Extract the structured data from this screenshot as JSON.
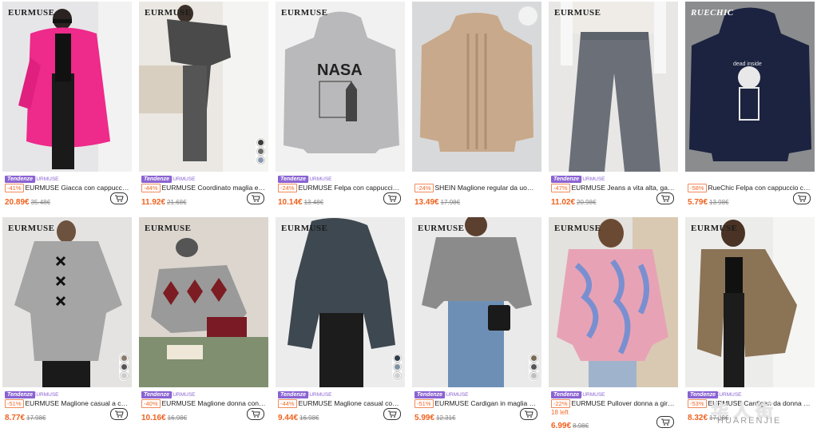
{
  "products": [
    {
      "brand": "EURMUSE",
      "badge": "Tendenze",
      "store": "EURMUSE",
      "discount": "-41%",
      "title": "EURMUSE Giacca con cappuccio versat...",
      "price": "20.89€",
      "original": "35.48€",
      "swatches": [],
      "stock": ""
    },
    {
      "brand": "EURMUSE",
      "badge": "Tendenze",
      "store": "EURMUSE",
      "discount": "-44%",
      "title": "EURMUSE Coordinato maglia e pantalo...",
      "price": "11.92€",
      "original": "21.68€",
      "swatches": [
        "#3a3a3a",
        "#6b6b6b",
        "#8a9bb0"
      ],
      "stock": ""
    },
    {
      "brand": "EURMUSE",
      "badge": "Tendenze",
      "store": "EURMUSE",
      "discount": "-24%",
      "title": "EURMUSE Felpa con cappuccio regular ...",
      "price": "10.14€",
      "original": "13.48€",
      "swatches": [],
      "stock": ""
    },
    {
      "brand": "",
      "badge": "",
      "store": "",
      "discount": "-24%",
      "title": "SHEIN Maglione regular da uomo a collo...",
      "price": "13.49€",
      "original": "17.98€",
      "swatches": [],
      "stock": ""
    },
    {
      "brand": "EURMUSE",
      "badge": "Tendenze",
      "store": "EURMUSE",
      "discount": "-47%",
      "title": "EURMUSE Jeans a vita alta, gamba dritt...",
      "price": "11.02€",
      "original": "20.98€",
      "swatches": [],
      "stock": ""
    },
    {
      "brand": "RUECHIC",
      "badge": "",
      "store": "",
      "discount": "-58%",
      "title": "RueChic Felpa con cappuccio casual da ...",
      "price": "5.79€",
      "original": "13.98€",
      "swatches": [],
      "stock": ""
    },
    {
      "brand": "EURMUSE",
      "badge": "Tendenze",
      "store": "EURMUSE",
      "discount": "-51%",
      "title": "EURMUSE Maglione casual a costine co...",
      "price": "8.77€",
      "original": "17.98€",
      "swatches": [
        "#8a7a6a",
        "#555",
        "#ccc"
      ],
      "stock": ""
    },
    {
      "brand": "EURMUSE",
      "badge": "Tendenze",
      "store": "EURMUSE",
      "discount": "-40%",
      "title": "EURMUSE Maglione donna con collo a ...",
      "price": "10.16€",
      "original": "16.98€",
      "swatches": [],
      "stock": ""
    },
    {
      "brand": "EURMUSE",
      "badge": "Tendenze",
      "store": "EURMUSE",
      "discount": "-44%",
      "title": "EURMUSE Maglione casual con cappuc...",
      "price": "9.44€",
      "original": "16.98€",
      "swatches": [
        "#2e3b48",
        "#7f93a3",
        "#d0d0d0"
      ],
      "stock": ""
    },
    {
      "brand": "EURMUSE",
      "badge": "Tendenze",
      "store": "EURMUSE",
      "discount": "-51%",
      "title": "EURMUSE Cardigan in maglia a trecce s...",
      "price": "5.99€",
      "original": "12.31€",
      "swatches": [
        "#7a6a55",
        "#555",
        "#bfbfbf"
      ],
      "stock": ""
    },
    {
      "brand": "EURMUSE",
      "badge": "Tendenze",
      "store": "EURMUSE",
      "discount": "-22%",
      "title": "EURMUSE Pullover donna a girocollo co...",
      "price": "6.99€",
      "original": "8.98€",
      "swatches": [],
      "stock": "18 left"
    },
    {
      "brand": "EURMUSE",
      "badge": "Tendenze",
      "store": "EURMUSE",
      "discount": "-53%",
      "title": "EURMUSE Cardigan da donna con mani...",
      "price": "8.32€",
      "original": "17.98€",
      "swatches": [],
      "stock": ""
    }
  ],
  "watermark": {
    "main": "华人街",
    "sub": "HUARENJIE"
  },
  "colors": {
    "accent": "#f0621e",
    "badge": "#8a63d2"
  }
}
